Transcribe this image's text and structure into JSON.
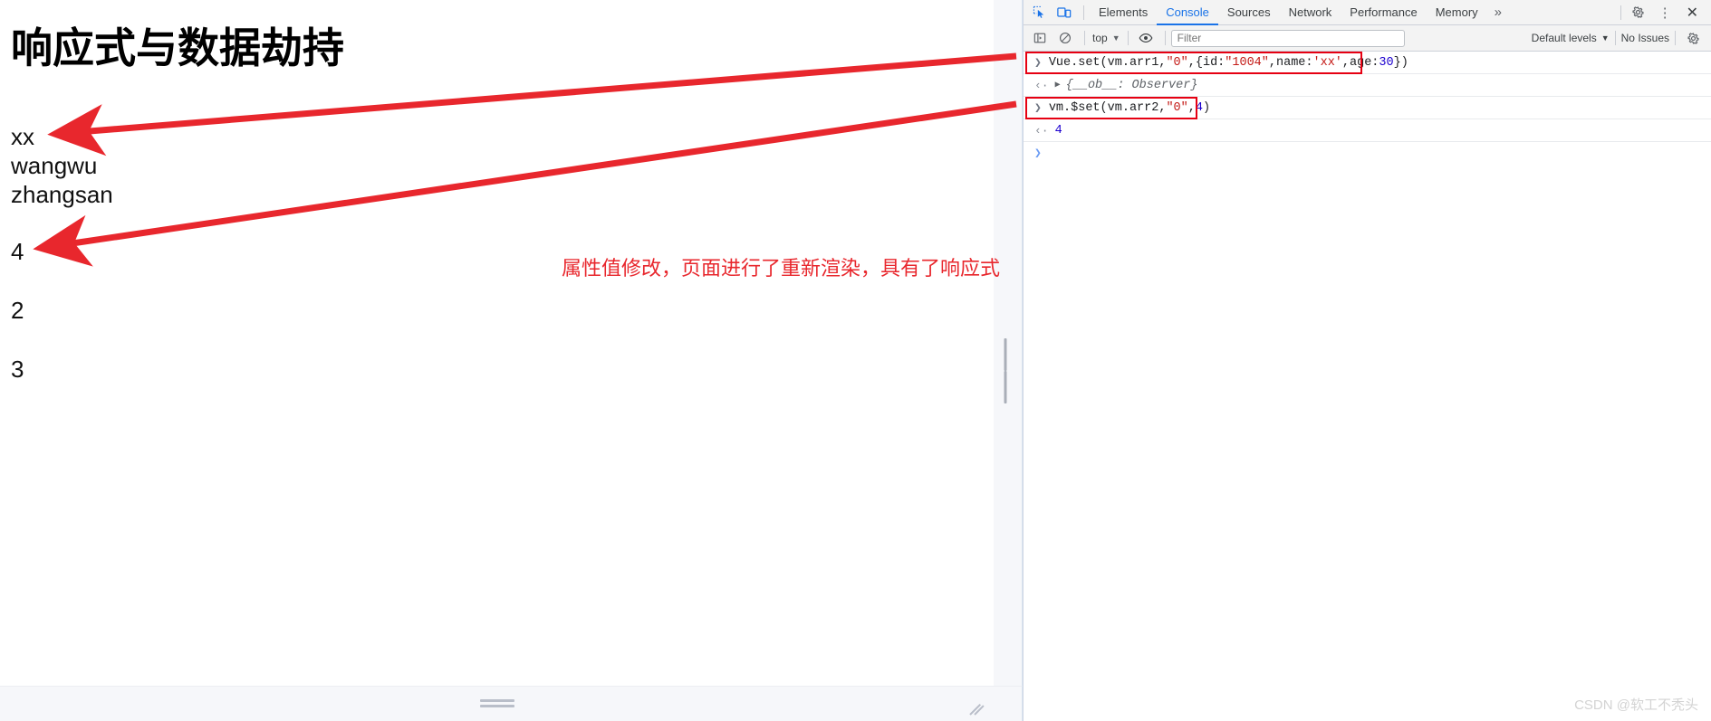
{
  "page": {
    "title": "响应式与数据劫持",
    "names": [
      "xx",
      "wangwu",
      "zhangsan"
    ],
    "numbers": [
      "4",
      "2",
      "3"
    ]
  },
  "annotation": {
    "text": "属性值修改，页面进行了重新渲染，具有了响应式",
    "color": "#e8272d"
  },
  "devtools": {
    "inspect_icon": "inspect-element-icon",
    "device_icon": "device-toolbar-icon",
    "tabs": [
      {
        "label": "Elements",
        "active": false
      },
      {
        "label": "Console",
        "active": true
      },
      {
        "label": "Sources",
        "active": false
      },
      {
        "label": "Network",
        "active": false
      },
      {
        "label": "Performance",
        "active": false
      },
      {
        "label": "Memory",
        "active": false
      }
    ],
    "more_tabs": "»",
    "settings_icon": "gear-icon",
    "kebab_icon": "more-options-icon",
    "close_icon": "close-icon",
    "toolbar": {
      "sidebar_icon": "console-sidebar-icon",
      "clear_icon": "clear-console-icon",
      "context": "top",
      "context_caret": "▼",
      "eye_icon": "live-expression-eye-icon",
      "filter_placeholder": "Filter",
      "filter_value": "",
      "levels": "Default levels",
      "levels_caret": "▼",
      "issues": "No Issues",
      "settings_icon": "console-settings-gear-icon"
    },
    "console": {
      "accent": "#1a73e8",
      "highlight": "#e60012",
      "entries": [
        {
          "kind": "input",
          "caret": "❯",
          "boxed": true,
          "parts": [
            {
              "t": "Vue.set(vm.arr1,",
              "c": "code"
            },
            {
              "t": "\"0\"",
              "c": "s-str"
            },
            {
              "t": ",{id:",
              "c": "code"
            },
            {
              "t": "\"1004\"",
              "c": "s-str"
            },
            {
              "t": ",name:",
              "c": "code"
            },
            {
              "t": "'xx'",
              "c": "s-str"
            },
            {
              "t": ",age:",
              "c": "code"
            },
            {
              "t": "30",
              "c": "s-num"
            },
            {
              "t": "})",
              "c": "code"
            }
          ]
        },
        {
          "kind": "output",
          "caret": "‹·",
          "disclosure": "▶",
          "boxed": false,
          "preview": "{__ob__: Observer}"
        },
        {
          "kind": "input",
          "caret": "❯",
          "boxed": true,
          "parts": [
            {
              "t": "vm.$set(vm.arr2,",
              "c": "code"
            },
            {
              "t": "\"0\"",
              "c": "s-str"
            },
            {
              "t": ",",
              "c": "code"
            },
            {
              "t": "4",
              "c": "s-num"
            },
            {
              "t": ")",
              "c": "code"
            }
          ]
        },
        {
          "kind": "output",
          "caret": "‹·",
          "boxed": false,
          "result": "4"
        },
        {
          "kind": "prompt",
          "caret": "❯",
          "boxed": false
        }
      ]
    }
  },
  "watermark": "CSDN @软工不秃头"
}
